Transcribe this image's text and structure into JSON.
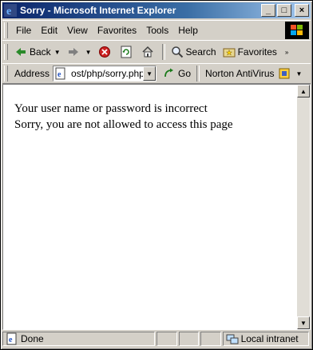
{
  "window": {
    "title": "Sorry - Microsoft Internet Explorer"
  },
  "window_buttons": {
    "minimize": "_",
    "maximize": "□",
    "close": "×"
  },
  "menu": [
    "File",
    "Edit",
    "View",
    "Favorites",
    "Tools",
    "Help"
  ],
  "toolbar": {
    "back": "Back",
    "search": "Search",
    "favorites": "Favorites"
  },
  "address": {
    "label": "Address",
    "value": "ost/php/sorry.php",
    "go": "Go",
    "norton": "Norton AntiVirus"
  },
  "content": {
    "line1": "Your user name or password is incorrect",
    "line2": "Sorry, you are not allowed to access this page"
  },
  "status": {
    "text": "Done",
    "zone": "Local intranet"
  },
  "colors": {
    "title_bar_start": "#0a246a",
    "title_bar_end": "#a6caf0",
    "chrome": "#d4d0c8"
  }
}
